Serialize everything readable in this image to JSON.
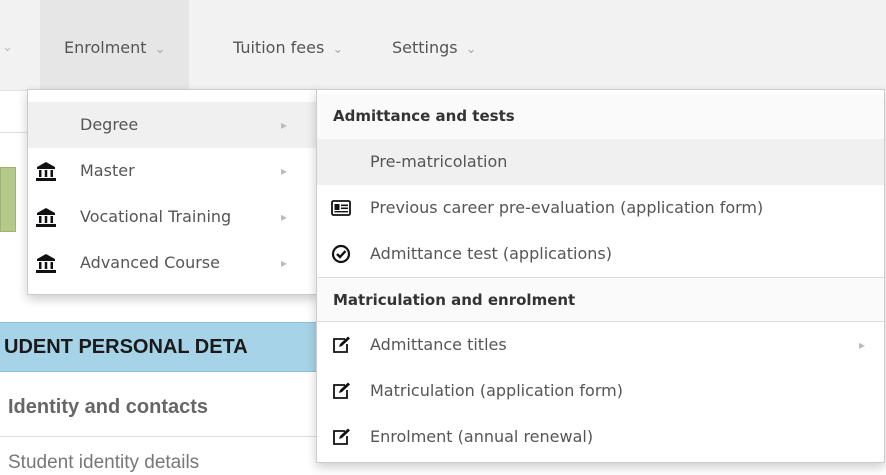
{
  "navbar": {
    "items": [
      {
        "label": "Enrolment",
        "caret": "⌄"
      },
      {
        "label": "Tuition fees",
        "caret": "⌄"
      },
      {
        "label": "Settings",
        "caret": "⌄"
      }
    ],
    "left_caret": "⌄"
  },
  "menu_level1": {
    "items": [
      {
        "label": "Degree",
        "icon": "none",
        "arrow": "▸"
      },
      {
        "label": "Master",
        "icon": "institution-icon",
        "arrow": "▸"
      },
      {
        "label": "Vocational Training",
        "icon": "institution-icon",
        "arrow": "▸"
      },
      {
        "label": "Advanced Course",
        "icon": "institution-icon",
        "arrow": "▸"
      }
    ]
  },
  "menu_level2": {
    "headers": [
      "Admittance and tests",
      "Matriculation and enrolment"
    ],
    "items": [
      {
        "label": "Pre-matricolation",
        "icon": "none"
      },
      {
        "label": "Previous career pre-evaluation (application form)",
        "icon": "id-card-icon"
      },
      {
        "label": "Admittance test (applications)",
        "icon": "check-circle-icon"
      },
      {
        "label": "Admittance titles",
        "icon": "edit-icon",
        "arrow": "▸"
      },
      {
        "label": "Matriculation (application form)",
        "icon": "edit-icon"
      },
      {
        "label": "Enrolment (annual renewal)",
        "icon": "edit-icon"
      }
    ]
  },
  "background": {
    "section_title": "UDENT PERSONAL DETA",
    "identity_heading": "Identity and contacts",
    "identity_subheading": "Student identity details"
  },
  "colors": {
    "section_header_bg": "#a7d3e8",
    "navbar_bg": "#f2f2f2",
    "active_item_bg": "#f0f0f0"
  }
}
